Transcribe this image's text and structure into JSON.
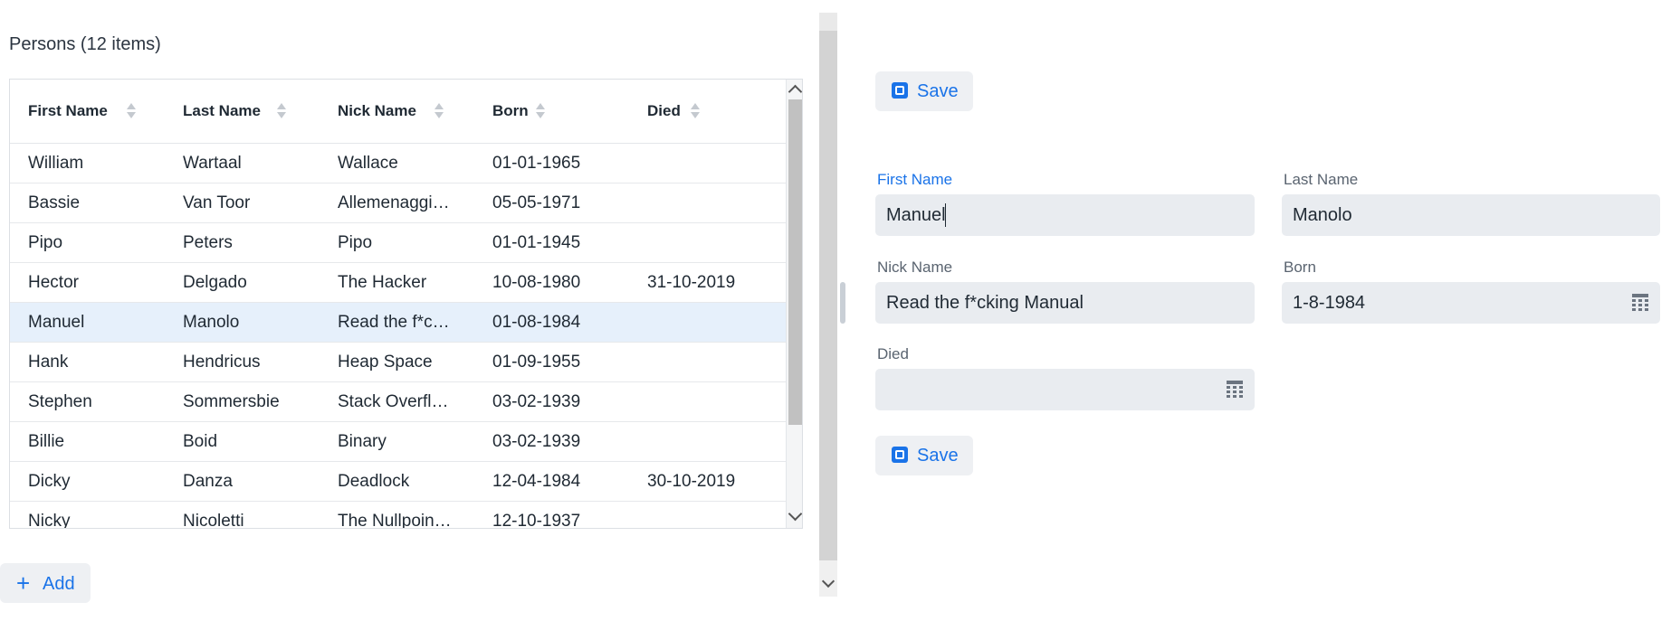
{
  "grid": {
    "title": "Persons (12 items)",
    "columns": [
      "First Name",
      "Last Name",
      "Nick Name",
      "Born",
      "Died"
    ],
    "rows": [
      {
        "first": "William",
        "last": "Wartaal",
        "nick": "Wallace",
        "born": "01-01-1965",
        "died": ""
      },
      {
        "first": "Bassie",
        "last": "Van Toor",
        "nick": "Allemenaggi…",
        "born": "05-05-1971",
        "died": ""
      },
      {
        "first": "Pipo",
        "last": "Peters",
        "nick": "Pipo",
        "born": "01-01-1945",
        "died": ""
      },
      {
        "first": "Hector",
        "last": "Delgado",
        "nick": "The Hacker",
        "born": "10-08-1980",
        "died": "31-10-2019"
      },
      {
        "first": "Manuel",
        "last": "Manolo",
        "nick": "Read the f*c…",
        "born": "01-08-1984",
        "died": ""
      },
      {
        "first": "Hank",
        "last": "Hendricus",
        "nick": "Heap Space",
        "born": "01-09-1955",
        "died": ""
      },
      {
        "first": "Stephen",
        "last": "Sommersbie",
        "nick": "Stack Overfl…",
        "born": "03-02-1939",
        "died": ""
      },
      {
        "first": "Billie",
        "last": "Boid",
        "nick": "Binary",
        "born": "03-02-1939",
        "died": ""
      },
      {
        "first": "Dicky",
        "last": "Danza",
        "nick": "Deadlock",
        "born": "12-04-1984",
        "died": "30-10-2019"
      },
      {
        "first": "Nicky",
        "last": "Nicoletti",
        "nick": "The Nullpoin…",
        "born": "12-10-1937",
        "died": ""
      }
    ],
    "selected_row": 4,
    "add_label": "Add"
  },
  "form": {
    "save_label": "Save",
    "first_name_label": "First Name",
    "first_name_value": "Manuel",
    "last_name_label": "Last Name",
    "last_name_value": "Manolo",
    "nick_name_label": "Nick Name",
    "nick_name_value": "Read the f*cking Manual",
    "born_label": "Born",
    "born_value": "1-8-1984",
    "died_label": "Died",
    "died_value": ""
  },
  "colors": {
    "accent": "#1a73e8",
    "selected_row": "#e6f0fb",
    "field_background": "#e9ecf0"
  },
  "icons": [
    "sort-icon",
    "plus-icon",
    "save-icon",
    "calendar-icon",
    "chevron-up-icon",
    "chevron-down-icon"
  ]
}
